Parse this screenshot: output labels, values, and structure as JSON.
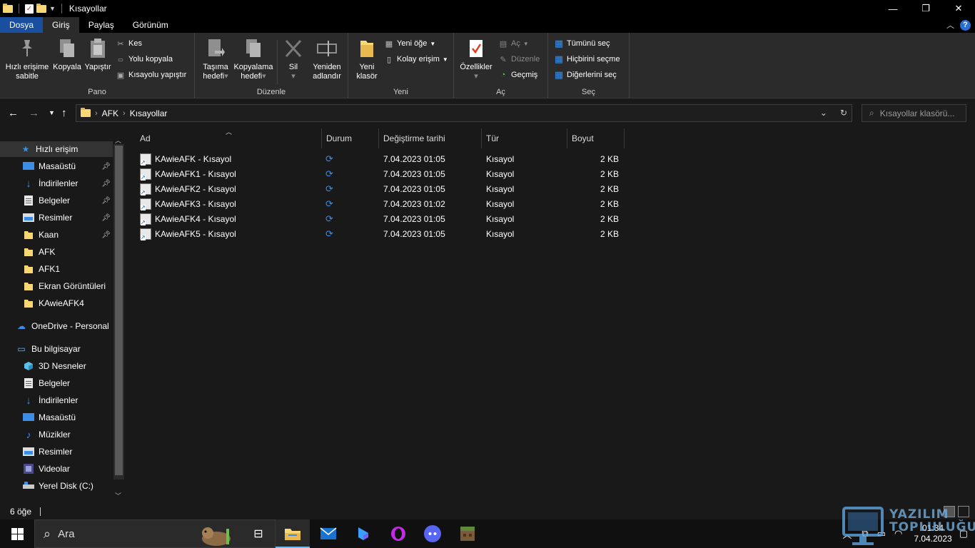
{
  "window": {
    "title": "Kısayollar",
    "controls": {
      "minimize": "—",
      "maximize": "❐",
      "close": "✕"
    }
  },
  "ribbon_tabs": [
    "Dosya",
    "Giriş",
    "Paylaş",
    "Görünüm"
  ],
  "ribbon": {
    "pano": {
      "label": "Pano",
      "pin_quick": [
        "Hızlı erişime",
        "sabitle"
      ],
      "copy": "Kopyala",
      "paste": "Yapıştır",
      "cut": "Kes",
      "copy_path": "Yolu kopyala",
      "paste_shortcut": "Kısayolu yapıştır"
    },
    "duzenle": {
      "label": "Düzenle",
      "move_to": [
        "Taşıma",
        "hedefi"
      ],
      "copy_to": [
        "Kopyalama",
        "hedefi"
      ],
      "delete": "Sil",
      "rename": [
        "Yeniden",
        "adlandır"
      ]
    },
    "yeni": {
      "label": "Yeni",
      "new_folder": [
        "Yeni",
        "klasör"
      ],
      "new_item": "Yeni öğe",
      "easy_access": "Kolay erişim"
    },
    "ac": {
      "label": "Aç",
      "properties": "Özellikler",
      "open": "Aç",
      "edit": "Düzenle",
      "history": "Geçmiş"
    },
    "sec": {
      "label": "Seç",
      "select_all": "Tümünü seç",
      "select_none": "Hiçbirini seçme",
      "invert": "Diğerlerini seç"
    }
  },
  "address": {
    "crumbs": [
      "AFK",
      "Kısayollar"
    ],
    "search_placeholder": "Kısayollar klasörü..."
  },
  "nav": {
    "quick_access": "Hızlı erişim",
    "pinned": [
      "Masaüstü",
      "İndirilenler",
      "Belgeler",
      "Resimler",
      "Kaan"
    ],
    "folders": [
      "AFK",
      "AFK1",
      "Ekran Görüntüleri",
      "KAwieAFK4"
    ],
    "onedrive": "OneDrive - Personal",
    "this_pc": "Bu bilgisayar",
    "pc_items": [
      "3D Nesneler",
      "Belgeler",
      "İndirilenler",
      "Masaüstü",
      "Müzikler",
      "Resimler",
      "Videolar",
      "Yerel Disk (C:)"
    ]
  },
  "columns": [
    "Ad",
    "Durum",
    "Değiştirme tarihi",
    "Tür",
    "Boyut"
  ],
  "files": [
    {
      "name": "KAwieAFK - Kısayol",
      "date": "7.04.2023 01:05",
      "type": "Kısayol",
      "size": "2 KB"
    },
    {
      "name": "KAwieAFK1 - Kısayol",
      "date": "7.04.2023 01:05",
      "type": "Kısayol",
      "size": "2 KB"
    },
    {
      "name": "KAwieAFK2 - Kısayol",
      "date": "7.04.2023 01:05",
      "type": "Kısayol",
      "size": "2 KB"
    },
    {
      "name": "KAwieAFK3 - Kısayol",
      "date": "7.04.2023 01:02",
      "type": "Kısayol",
      "size": "2 KB"
    },
    {
      "name": "KAwieAFK4 - Kısayol",
      "date": "7.04.2023 01:05",
      "type": "Kısayol",
      "size": "2 KB"
    },
    {
      "name": "KAwieAFK5 - Kısayol",
      "date": "7.04.2023 01:05",
      "type": "Kısayol",
      "size": "2 KB"
    }
  ],
  "status": {
    "count": "6 öğe"
  },
  "taskbar": {
    "search_label": "Ara",
    "time": "01:34",
    "date": "7.04.2023"
  },
  "watermark": {
    "line1": "YAZILIM",
    "line2": "TOPLULUĞU"
  },
  "colors": {
    "accent": "#1a4fa0",
    "sync": "#3b8ee8",
    "folder": "#f8d775"
  }
}
